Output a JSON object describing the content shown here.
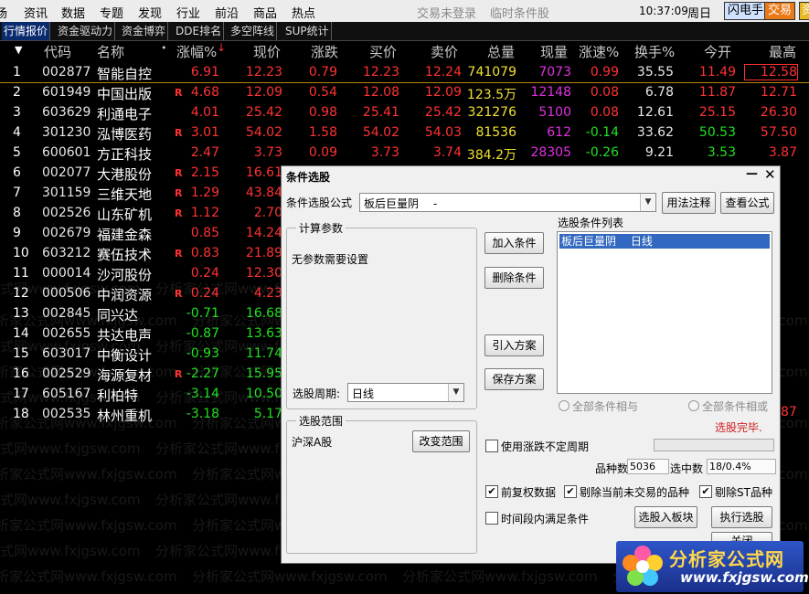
{
  "menu": {
    "items": [
      "资讯",
      "数据",
      "专题",
      "发现",
      "行业",
      "前沿",
      "商品",
      "热点"
    ],
    "leading_fragment": "场",
    "login_status": "交易未登录",
    "temp_condition": "临时条件股",
    "time": "10:37:09",
    "weekday": "周日",
    "flash_label": "闪电手",
    "trade_label": "交易",
    "extra_label": "资"
  },
  "tabs": [
    "行情报价",
    "资金驱动力",
    "资金博弈",
    "DDE排名",
    "多空阵线",
    "SUP统计"
  ],
  "table": {
    "headers": {
      "code": "代码",
      "name": "名称",
      "dot": "•",
      "change_pct": "涨幅%",
      "price": "现价",
      "change": "涨跌",
      "bid": "买价",
      "ask": "卖价",
      "volume": "总量",
      "cur_vol": "现量",
      "speed": "涨速%",
      "turnover": "换手%",
      "open": "今开",
      "high": "最高"
    },
    "rows": [
      {
        "idx": "1",
        "code": "002877",
        "name": "智能自控",
        "r": "",
        "pct": "6.91",
        "price": "12.23",
        "chg": "0.79",
        "bid": "12.23",
        "ask": "12.24",
        "vol": "741079",
        "cur": "7073",
        "speed": "0.99",
        "turn": "35.55",
        "open": "11.49",
        "high": "12.58"
      },
      {
        "idx": "2",
        "code": "601949",
        "name": "中国出版",
        "r": "R",
        "pct": "4.68",
        "price": "12.09",
        "chg": "0.54",
        "bid": "12.08",
        "ask": "12.09",
        "vol": "123.5万",
        "cur": "12148",
        "speed": "0.08",
        "turn": "6.78",
        "open": "11.87",
        "high": "12.71"
      },
      {
        "idx": "3",
        "code": "603629",
        "name": "利通电子",
        "r": "",
        "pct": "4.01",
        "price": "25.42",
        "chg": "0.98",
        "bid": "25.41",
        "ask": "25.42",
        "vol": "321276",
        "cur": "5100",
        "speed": "0.08",
        "turn": "12.61",
        "open": "25.15",
        "high": "26.30"
      },
      {
        "idx": "4",
        "code": "301230",
        "name": "泓博医药",
        "r": "R",
        "pct": "3.01",
        "price": "54.02",
        "chg": "1.58",
        "bid": "54.02",
        "ask": "54.03",
        "vol": "81536",
        "cur": "612",
        "speed": "-0.14",
        "turn": "33.62",
        "open": "50.53",
        "high": "57.50"
      },
      {
        "idx": "5",
        "code": "600601",
        "name": "方正科技",
        "r": "",
        "pct": "2.47",
        "price": "3.73",
        "chg": "0.09",
        "bid": "3.73",
        "ask": "3.74",
        "vol": "384.2万",
        "cur": "28305",
        "speed": "-0.26",
        "turn": "9.21",
        "open": "3.53",
        "high": "3.87"
      },
      {
        "idx": "6",
        "code": "002077",
        "name": "大港股份",
        "r": "R",
        "pct": "2.15",
        "price": "16.61"
      },
      {
        "idx": "7",
        "code": "301159",
        "name": "三维天地",
        "r": "R",
        "pct": "1.29",
        "price": "43.84"
      },
      {
        "idx": "8",
        "code": "002526",
        "name": "山东矿机",
        "r": "R",
        "pct": "1.12",
        "price": "2.70"
      },
      {
        "idx": "9",
        "code": "002679",
        "name": "福建金森",
        "r": "",
        "pct": "0.85",
        "price": "14.24"
      },
      {
        "idx": "10",
        "code": "603212",
        "name": "赛伍技术",
        "r": "R",
        "pct": "0.83",
        "price": "21.89"
      },
      {
        "idx": "11",
        "code": "000014",
        "name": "沙河股份",
        "r": "",
        "pct": "0.24",
        "price": "12.30"
      },
      {
        "idx": "12",
        "code": "000506",
        "name": "中润资源",
        "r": "R",
        "pct": "0.24",
        "price": "4.23"
      },
      {
        "idx": "13",
        "code": "002845",
        "name": "同兴达",
        "r": "",
        "pct": "-0.71",
        "price": "16.68"
      },
      {
        "idx": "14",
        "code": "002655",
        "name": "共达电声",
        "r": "",
        "pct": "-0.87",
        "price": "13.63"
      },
      {
        "idx": "15",
        "code": "603017",
        "name": "中衡设计",
        "r": "",
        "pct": "-0.93",
        "price": "11.74"
      },
      {
        "idx": "16",
        "code": "002529",
        "name": "海源复材",
        "r": "R",
        "pct": "-2.27",
        "price": "15.95"
      },
      {
        "idx": "17",
        "code": "605167",
        "name": "利柏特",
        "r": "",
        "pct": "-3.14",
        "price": "10.50"
      },
      {
        "idx": "18",
        "code": "002535",
        "name": "林州重机",
        "r": "",
        "pct": "-3.18",
        "price": "5.17"
      }
    ],
    "right_edge_partial": "87"
  },
  "dialog": {
    "title": "条件选股",
    "formula_label": "条件选股公式",
    "formula_value": "板后巨量阴  　-",
    "usage_btn": "用法注释",
    "view_btn": "查看公式",
    "params_group": "计算参数",
    "params_text": "无参数需要设置",
    "add_btn": "加入条件",
    "delete_btn": "删除条件",
    "import_btn": "引入方案",
    "save_btn": "保存方案",
    "cond_list_label": "选股条件列表",
    "cond_items": [
      "板后巨量阴　 日线"
    ],
    "and_label": "全部条件相与",
    "or_label": "全部条件相或",
    "period_label": "选股周期:",
    "period_value": "日线",
    "range_group": "选股范围",
    "range_value": "沪深A股",
    "change_range_btn": "改变范围",
    "done_text": "选股完毕.",
    "uncertain_period": "使用涨跌不定周期",
    "stock_count_label": "品种数",
    "stock_count": "5036",
    "selected_label": "选中数",
    "selected_value": "18/0.4%",
    "restored_data": "前复权数据",
    "exclude_untraded": "剔除当前未交易的品种",
    "exclude_st": "剔除ST品种",
    "interval_meet": "时间段内满足条件",
    "to_board_btn": "选股入板块",
    "run_btn": "执行选股",
    "close_btn": "关闭"
  },
  "watermark": "分析家公式网www.fxjgsw.com",
  "logo": {
    "title": "分析家公式网",
    "url": "www.fxjgsw.com"
  },
  "colors": {
    "up": "#ff3232",
    "down": "#20e020",
    "volume": "#f0e030",
    "cur_volume": "#e030e0",
    "tab_active": "#0a2a6e"
  }
}
